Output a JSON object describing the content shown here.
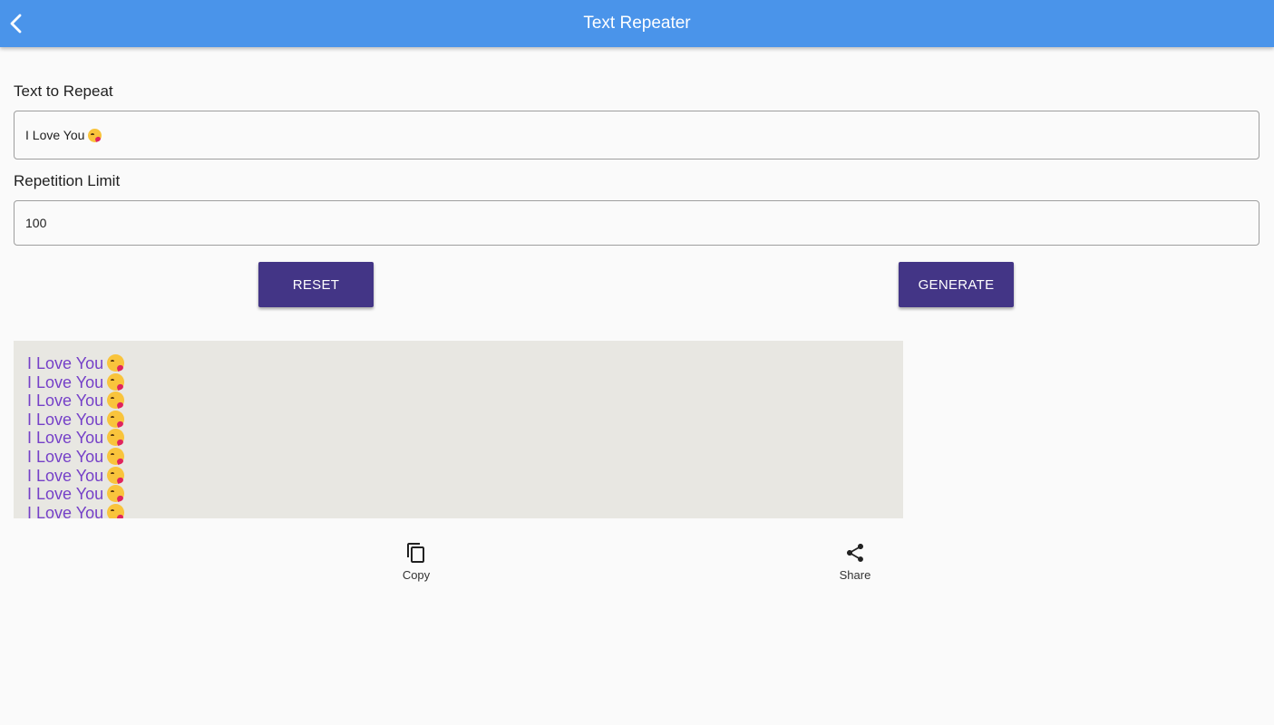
{
  "appbar": {
    "title": "Text Repeater",
    "back_icon": "arrow-back-icon",
    "color": "#4a94ea"
  },
  "form": {
    "text_label": "Text to Repeat",
    "text_value": "I Love You",
    "text_emoji": "kissing-face-emoji",
    "limit_label": "Repetition Limit",
    "limit_value": "100"
  },
  "buttons": {
    "reset": "RESET",
    "generate": "GENERATE",
    "color": "#433586"
  },
  "output": {
    "lines": [
      "I Love You",
      "I Love You",
      "I Love You",
      "I Love You",
      "I Love You",
      "I Love You",
      "I Love You",
      "I Love You",
      "I Love You"
    ],
    "emoji": "kissing-face-emoji",
    "text_color": "#7540c8",
    "background": "#e8e7e2"
  },
  "actions": {
    "copy": {
      "label": "Copy",
      "icon": "copy-icon"
    },
    "share": {
      "label": "Share",
      "icon": "share-icon"
    }
  }
}
